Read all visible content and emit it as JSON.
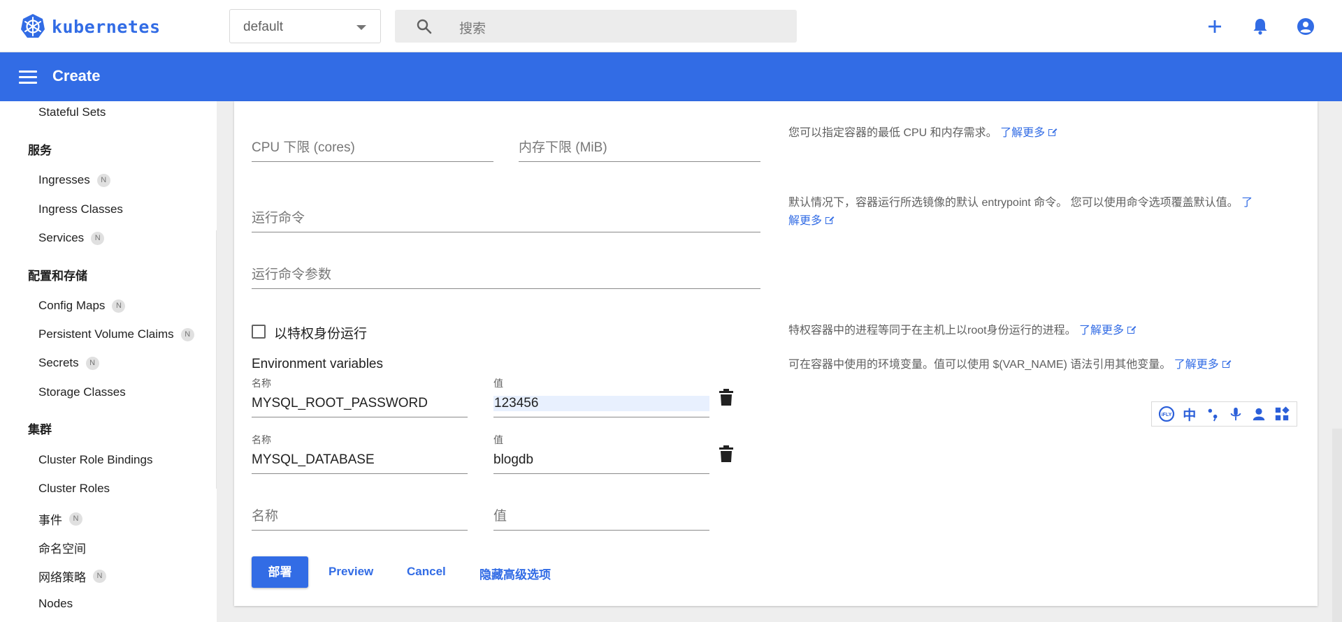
{
  "brand": {
    "name": "kubernetes",
    "color": "#326ce5"
  },
  "header": {
    "namespace": "default",
    "search_placeholder": "搜索",
    "icons": [
      "add-icon",
      "notifications-icon",
      "account-icon"
    ]
  },
  "titlebar": {
    "title": "Create"
  },
  "sidebar": {
    "items": [
      {
        "type": "item",
        "label": "Stateful Sets",
        "badge": ""
      },
      {
        "type": "section",
        "label": "服务"
      },
      {
        "type": "item",
        "label": "Ingresses",
        "badge": "N"
      },
      {
        "type": "item",
        "label": "Ingress Classes",
        "badge": ""
      },
      {
        "type": "item",
        "label": "Services",
        "badge": "N"
      },
      {
        "type": "section",
        "label": "配置和存储"
      },
      {
        "type": "item",
        "label": "Config Maps",
        "badge": "N"
      },
      {
        "type": "item",
        "label": "Persistent Volume Claims",
        "badge": "N"
      },
      {
        "type": "item",
        "label": "Secrets",
        "badge": "N"
      },
      {
        "type": "item",
        "label": "Storage Classes",
        "badge": ""
      },
      {
        "type": "section",
        "label": "集群"
      },
      {
        "type": "item",
        "label": "Cluster Role Bindings",
        "badge": ""
      },
      {
        "type": "item",
        "label": "Cluster Roles",
        "badge": ""
      },
      {
        "type": "item",
        "label": "事件",
        "badge": "N"
      },
      {
        "type": "item",
        "label": "命名空间",
        "badge": ""
      },
      {
        "type": "item",
        "label": "网络策略",
        "badge": "N"
      },
      {
        "type": "item",
        "label": "Nodes",
        "badge": ""
      }
    ]
  },
  "form": {
    "cpu_placeholder": "CPU 下限 (cores)",
    "memory_placeholder": "内存下限 (MiB)",
    "resources_help": "您可以指定容器的最低 CPU 和内存需求。",
    "command_placeholder": "运行命令",
    "command_help": "默认情况下，容器运行所选镜像的默认 entrypoint 命令。 您可以使用命令选项覆盖默认值。",
    "args_placeholder": "运行命令参数",
    "privileged_label": "以特权身份运行",
    "privileged_checked": false,
    "privileged_help": "特权容器中的进程等同于在主机上以root身份运行的进程。",
    "env_title": "Environment variables",
    "env_help": "可在容器中使用的环境变量。值可以使用 $(VAR_NAME) 语法引用其他变量。",
    "learn_more": "了解更多",
    "learn_more_split_a": "了",
    "learn_more_split_b": "解更多",
    "name_label": "名称",
    "value_label": "值",
    "env_vars": [
      {
        "name": "MYSQL_ROOT_PASSWORD",
        "value": "123456"
      },
      {
        "name": "MYSQL_DATABASE",
        "value": "blogdb"
      }
    ],
    "new_name_placeholder": "名称",
    "new_value_placeholder": "值"
  },
  "actions": {
    "deploy": "部署",
    "preview": "Preview",
    "cancel": "Cancel",
    "hide_advanced": "隐藏高级选项"
  },
  "ime_toolbar": [
    "ifly-logo-icon",
    "中",
    "punctuation-icon",
    "microphone-icon",
    "user-icon",
    "apps-icon"
  ]
}
